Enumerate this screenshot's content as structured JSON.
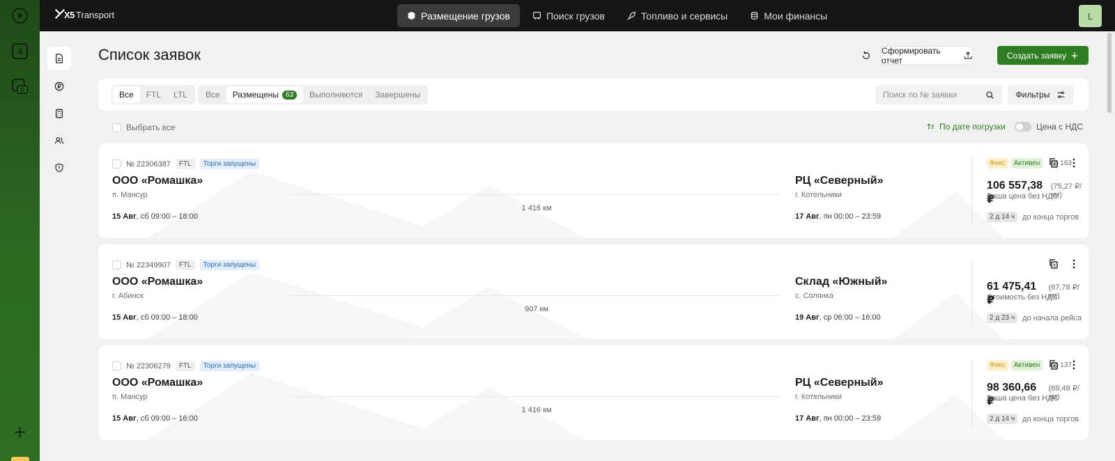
{
  "header": {
    "logo_mark": "X5",
    "logo_text": "Transport",
    "nav": [
      {
        "label": "Размещение грузов",
        "icon": "box-icon",
        "active": true
      },
      {
        "label": "Поиск грузов",
        "icon": "truck-icon",
        "active": false
      },
      {
        "label": "Топливо и сервисы",
        "icon": "rocket-icon",
        "active": false
      },
      {
        "label": "Мои финансы",
        "icon": "wallet-icon",
        "active": false
      }
    ],
    "avatar": "L"
  },
  "rail": {
    "items": [
      {
        "icon": "play-icon"
      },
      {
        "icon": "number-four-icon",
        "text": "4"
      },
      {
        "icon": "camera-icon"
      },
      {
        "icon": "plus-icon"
      }
    ]
  },
  "sidebar": {
    "items": [
      {
        "icon": "document-icon",
        "active": true
      },
      {
        "icon": "ruble-icon",
        "active": false
      },
      {
        "icon": "calculator-icon",
        "active": false
      },
      {
        "icon": "users-icon",
        "active": false
      },
      {
        "icon": "shield-icon",
        "active": false
      }
    ]
  },
  "page": {
    "title": "Список заявок",
    "report_button": "Сформировать отчет",
    "create_button": "Создать заявку"
  },
  "filters": {
    "type_tabs": [
      "Все",
      "FTL",
      "LTL"
    ],
    "type_selected": "Все",
    "status_tabs": [
      {
        "label": "Все"
      },
      {
        "label": "Размещены",
        "count": "63"
      },
      {
        "label": "Выполняются"
      },
      {
        "label": "Завершены"
      }
    ],
    "status_selected": "Размещены",
    "search_placeholder": "Поиск по № заявки",
    "filters_button": "Фильтры"
  },
  "toolbar": {
    "select_all": "Выбрать все",
    "sort_label": "По дате погрузки",
    "vat_label": "Цена с НДС"
  },
  "orders": [
    {
      "number": "№ 22306387",
      "type": "FTL",
      "status_tag": "Торги запущены",
      "from_company": "ООО «Ромашка»",
      "from_city": "п. Мансур",
      "from_date": "15 Авг",
      "from_time": ", сб 09:00 – 18:00",
      "distance": "1 416 км",
      "to_company": "РЦ «Северный»",
      "to_city": "г. Котельники",
      "to_date": "17 Авг",
      "to_time": ", пн 00:00 – 23:59",
      "badge_fix": "Фикс",
      "badge_active": "Активен",
      "views": "163",
      "price": "106 557,38 ₽",
      "price_per_km": "(75,27 ₽/км)",
      "price_note": "Ваша цена без НДС",
      "timer": "2 д 14 ч",
      "timer_note": "до конца торгов"
    },
    {
      "number": "№ 22349907",
      "type": "FTL",
      "status_tag": "Торги запущены",
      "from_company": "ООО «Ромашка»",
      "from_city": "г. Абинск",
      "from_date": "15 Авг",
      "from_time": ", сб 09:00 – 18:00",
      "distance": "907 км",
      "to_company": "Склад «Южный»",
      "to_city": "с. Солянка",
      "to_date": "19 Авг",
      "to_time": ", ср 06:00 – 16:00",
      "badge_fix": "",
      "badge_active": "",
      "views": "",
      "price": "61 475,41 ₽",
      "price_per_km": "(67,78 ₽/км)",
      "price_note": "Стоимость без НДС",
      "timer": "2 д 23 ч",
      "timer_note": "до начала рейса"
    },
    {
      "number": "№ 22306279",
      "type": "FTL",
      "status_tag": "Торги запущены",
      "from_company": "ООО «Ромашка»",
      "from_city": "п. Мансур",
      "from_date": "15 Авг",
      "from_time": ", сб 09:00 – 16:00",
      "distance": "1 416 км",
      "to_company": "РЦ «Северный»",
      "to_city": "г. Котельники",
      "to_date": "17 Авг",
      "to_time": ", пн 00:00 – 23:59",
      "badge_fix": "Фикс",
      "badge_active": "Активен",
      "views": "137",
      "price": "98 360,66 ₽",
      "price_per_km": "(69,48 ₽/км)",
      "price_note": "Ваша цена без НДС",
      "timer": "2 д 14 ч",
      "timer_note": "до конца торгов"
    }
  ],
  "colors": {
    "brand_green": "#2f7d22",
    "rail_green": "#2c6a22",
    "header_bg": "#161616",
    "auction_tag": "#2f6bb0",
    "fix_tag": "#c99a18"
  }
}
